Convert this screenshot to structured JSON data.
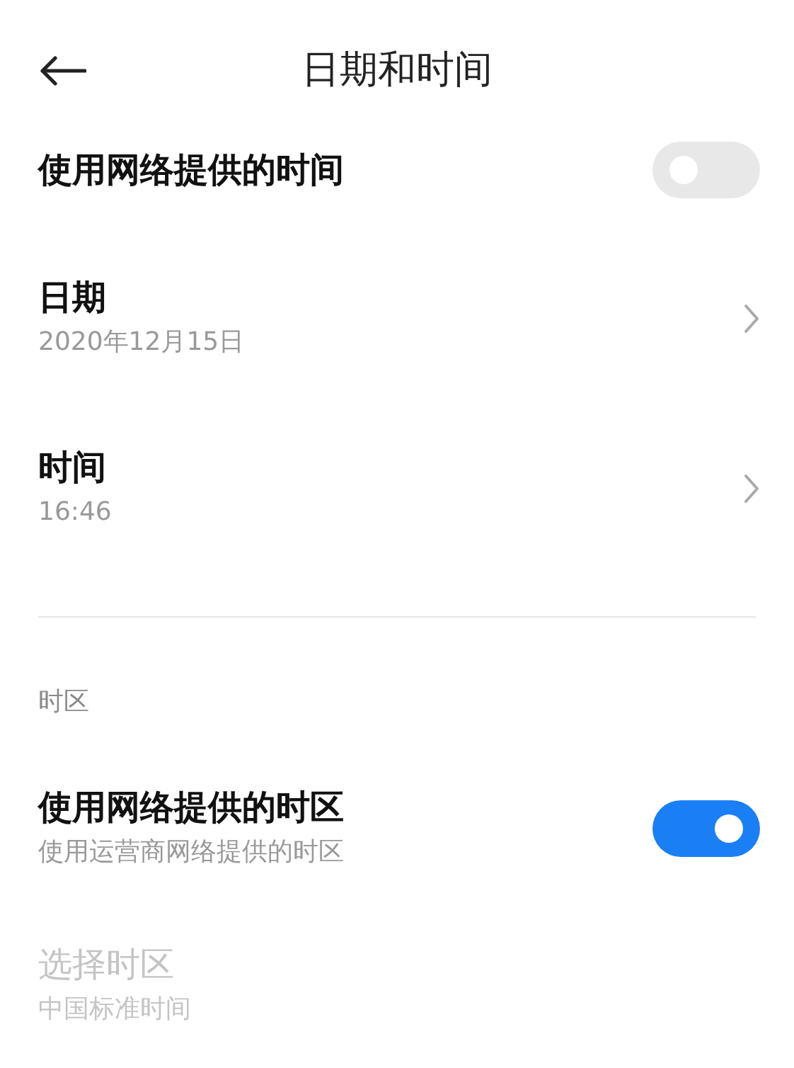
{
  "header": {
    "title": "日期和时间"
  },
  "sections": [
    {
      "items": [
        {
          "kind": "switch",
          "title": "使用网络提供的时间",
          "on": false,
          "disabled": false
        },
        {
          "kind": "link",
          "title": "日期",
          "subtitle": "2020年12月15日",
          "disabled": false
        },
        {
          "kind": "link",
          "title": "时间",
          "subtitle": "16:46",
          "disabled": false
        }
      ]
    },
    {
      "header": "时区",
      "items": [
        {
          "kind": "switch",
          "title": "使用网络提供的时区",
          "subtitle": "使用运营商网络提供的时区",
          "on": true,
          "disabled": false
        },
        {
          "kind": "link",
          "title": "选择时区",
          "subtitle": "中国标准时间",
          "disabled": true
        }
      ]
    }
  ]
}
